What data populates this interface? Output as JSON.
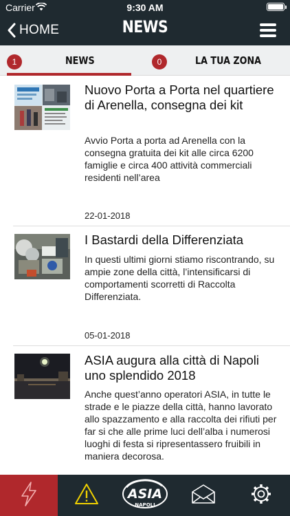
{
  "status_bar": {
    "carrier": "Carrier",
    "time": "9:30 AM"
  },
  "nav": {
    "back_label": "HOME",
    "title": "NEWS",
    "back_icon": "chevron-left-icon",
    "menu_icon": "hamburger-menu-icon"
  },
  "tabs": [
    {
      "label": "NEWS",
      "badge": "1",
      "selected": true
    },
    {
      "label": "LA TUA ZONA",
      "badge": "0",
      "selected": false
    }
  ],
  "articles": [
    {
      "title": "Nuovo Porta a Porta nel quartiere di Arenella, consegna dei kit",
      "excerpt": "Avvio Porta a porta ad Arenella con la consegna gratuita dei kit alle circa 6200 famiglie e circa 400 attività commerciali residenti nell’area",
      "date": "22-01-2018"
    },
    {
      "title": "I Bastardi della Differenziata",
      "excerpt": "In questi ultimi giorni stiamo riscontrando, su ampie zone della città, l’intensificarsi di comportamenti scorretti di Raccolta Differenziata.",
      "date": "05-01-2018"
    },
    {
      "title": "ASIA augura alla città di Napoli uno splendido 2018",
      "excerpt": "Anche quest’anno operatori ASIA, in tutte le strade e le piazze della città, hanno lavorato allo spazzamento e alla raccolta dei rifiuti per far si che alle prime luci dell’alba i numerosi luoghi di festa si ripresentassero fruibili in maniera decorosa.",
      "date": ""
    }
  ],
  "bottom_bar": {
    "logo_text": "ASIA",
    "logo_subtext": "NAPOLI",
    "items": [
      {
        "icon": "lightning-icon",
        "active": true
      },
      {
        "icon": "warning-icon",
        "active": false
      },
      {
        "icon": "asia-logo",
        "active": false
      },
      {
        "icon": "envelope-icon",
        "active": false
      },
      {
        "icon": "gear-icon",
        "active": false
      }
    ]
  },
  "colors": {
    "header_bg": "#1f2a30",
    "accent": "#b0282c",
    "warning_yellow": "#f2d200",
    "tabs_bg": "#eef0f1"
  }
}
